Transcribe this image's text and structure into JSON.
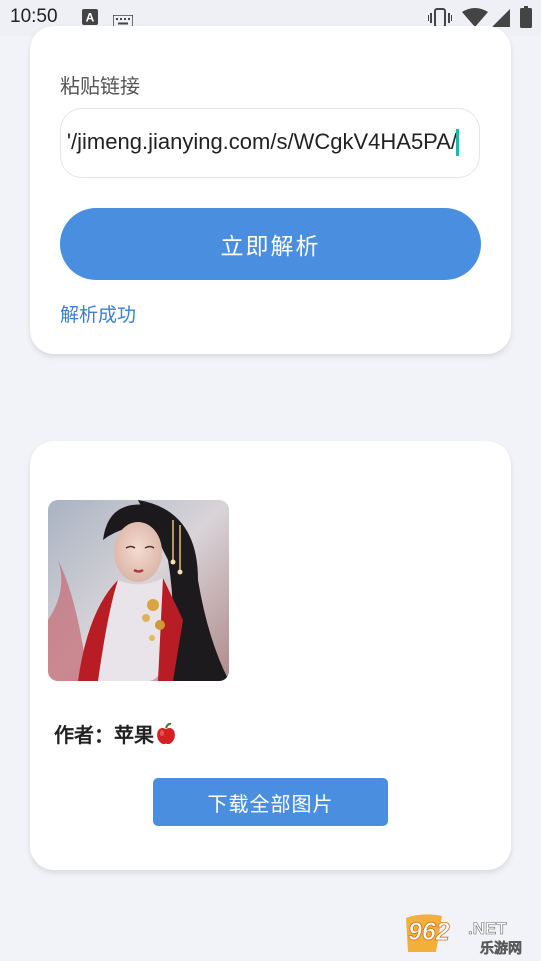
{
  "status_bar": {
    "time": "10:50",
    "icons": [
      "a-icon",
      "keyboard-icon",
      "vibrate-icon",
      "wifi-icon",
      "signal-icon",
      "battery-icon"
    ]
  },
  "parse_card": {
    "label": "粘贴链接",
    "input_value": "'/jimeng.jianying.com/s/WCgkV4HA5PA/",
    "button_label": "立即解析",
    "status_message": "解析成功"
  },
  "result_card": {
    "author": "作者：苹果",
    "author_emoji_icon": "apple-icon",
    "download_label": "下载全部图片"
  },
  "watermark": {
    "number": "962",
    "suffix": ".NET",
    "text": "乐游网"
  },
  "colors": {
    "accent": "#4a8fdf",
    "status_text": "#3d7fd0",
    "background": "#f2f3f8"
  }
}
